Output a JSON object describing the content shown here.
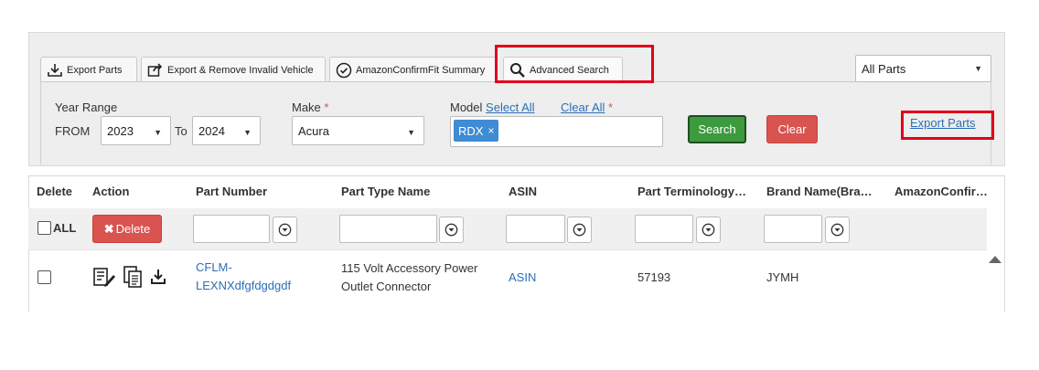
{
  "tabs": {
    "export_parts": "Export Parts",
    "export_remove_invalid": "Export & Remove Invalid Vehicle",
    "amazon_confirmfit_summary": "AmazonConfirmFit Summary",
    "advanced_search": "Advanced Search"
  },
  "parts_filter": {
    "selected": "All Parts"
  },
  "search_form": {
    "year_range_label": "Year Range",
    "from_label": "FROM",
    "from_value": "2023",
    "to_label": "To",
    "to_value": "2024",
    "make_label": "Make",
    "make_value": "Acura",
    "required_mark": "*",
    "model_label": "Model",
    "select_all": "Select All",
    "clear_all": "Clear All",
    "model_chip": "RDX",
    "chip_remove": "×",
    "search_button": "Search",
    "clear_button": "Clear",
    "export_parts_link": "Export Parts"
  },
  "table": {
    "columns": [
      "Delete",
      "Action",
      "Part Number",
      "Part Type Name",
      "ASIN",
      "Part Terminology…",
      "Brand Name(Bra…",
      "AmazonConfir…"
    ],
    "all_label": "ALL",
    "delete_button": "Delete",
    "rows": [
      {
        "part_number": "CFLM-LEXNXdfgfdgdgdf",
        "part_number_line1": "CFLM-",
        "part_number_line2": "LEXNXdfgfdgdgdf",
        "part_type_line1": "115 Volt Accessory Power",
        "part_type_line2": "Outlet Connector",
        "asin": "ASIN",
        "part_terminology": "57193",
        "brand_name": "JYMH"
      }
    ]
  },
  "colors": {
    "highlight": "#e0001b",
    "search": "#3d9a3f",
    "danger": "#d9534f",
    "link": "#2a6fb8",
    "chip": "#3f8bd4"
  }
}
